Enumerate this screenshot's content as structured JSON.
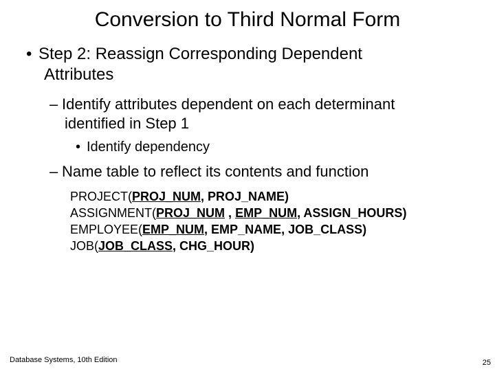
{
  "title": "Conversion to Third Normal Form",
  "step": {
    "line1": "Step 2: Reassign Corresponding Dependent",
    "line2": "Attributes"
  },
  "sub1": {
    "line1": "Identify attributes dependent on each determinant",
    "line2": "identified in Step 1"
  },
  "sub1a": "Identify dependency",
  "sub2": "Name table to reflect its contents and function",
  "schemas": {
    "r1": {
      "prefix": "PROJECT(",
      "k1": "PROJ_NUM",
      "mid": ", PROJ_NAME)"
    },
    "r2": {
      "prefix": "ASSIGNMENT(",
      "k1": "PROJ_NUM",
      "sep": " , ",
      "k2": "EMP_NUM",
      "mid": ", ASSIGN_HOURS)"
    },
    "r3": {
      "prefix": "EMPLOYEE(",
      "k1": "EMP_NUM",
      "mid": ", EMP_NAME, JOB_CLASS)"
    },
    "r4": {
      "prefix": "JOB(",
      "k1": "JOB_CLASS",
      "mid": ", CHG_HOUR)"
    }
  },
  "footer": {
    "left": "Database Systems, 10th Edition",
    "right": "25"
  }
}
